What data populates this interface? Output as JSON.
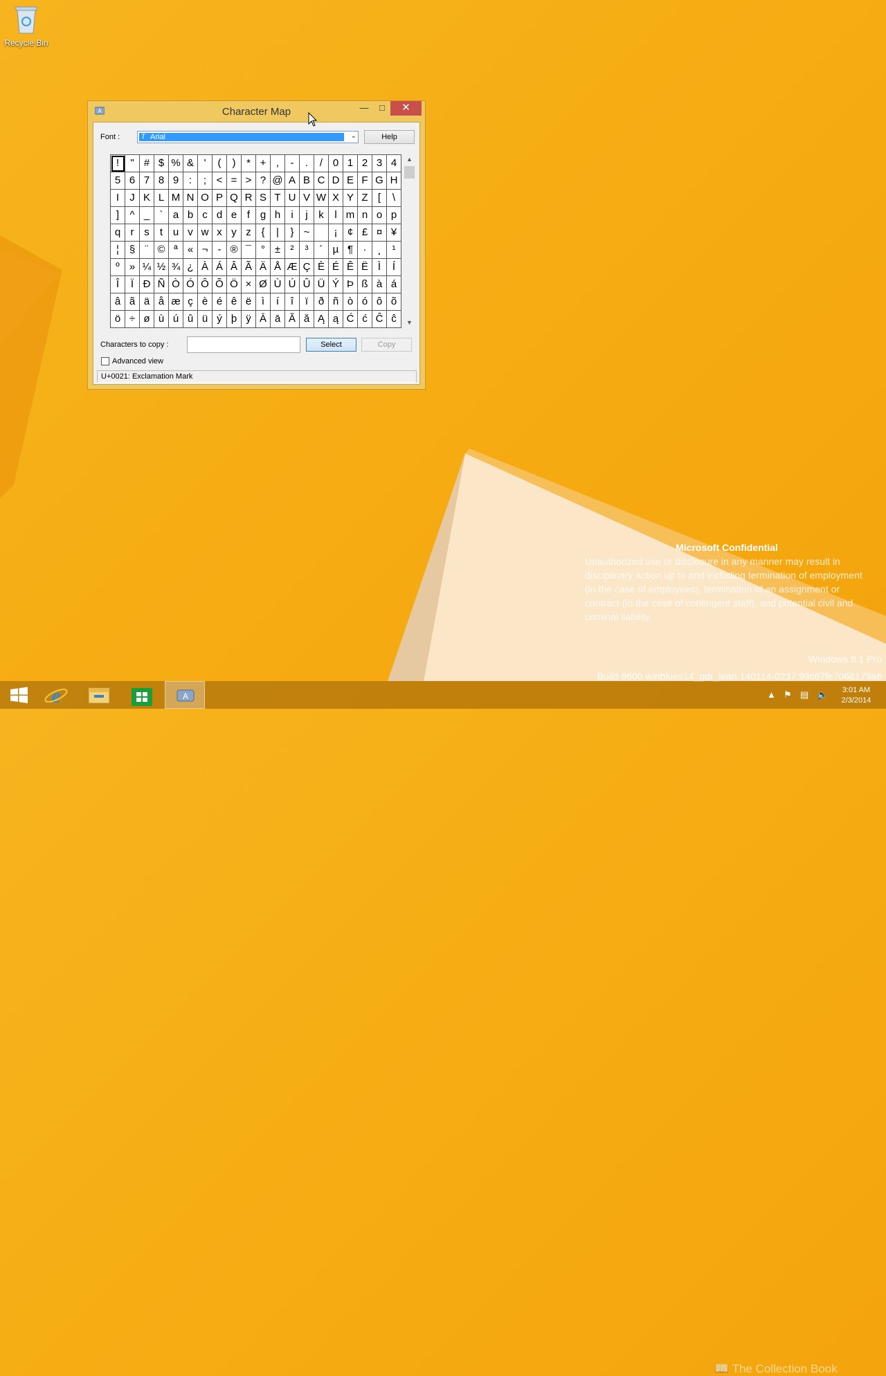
{
  "desktop": {
    "recycle_bin_label": "Recycle Bin"
  },
  "window": {
    "title": "Character Map",
    "font_label": "Font :",
    "font_value": "Arial",
    "help_label": "Help",
    "chars_to_copy_label": "Characters to copy :",
    "chars_to_copy_value": "",
    "select_label": "Select",
    "copy_label": "Copy",
    "advanced_label": "Advanced view",
    "advanced_checked": false,
    "status": "U+0021: Exclamation Mark",
    "selected_index": 0,
    "characters": [
      "!",
      "\"",
      "#",
      "$",
      "%",
      "&",
      "'",
      "(",
      ")",
      "*",
      "+",
      ",",
      "-",
      ".",
      "/",
      "0",
      "1",
      "2",
      "3",
      "4",
      "5",
      "6",
      "7",
      "8",
      "9",
      ":",
      ";",
      "<",
      "=",
      ">",
      "?",
      "@",
      "A",
      "B",
      "C",
      "D",
      "E",
      "F",
      "G",
      "H",
      "I",
      "J",
      "K",
      "L",
      "M",
      "N",
      "O",
      "P",
      "Q",
      "R",
      "S",
      "T",
      "U",
      "V",
      "W",
      "X",
      "Y",
      "Z",
      "[",
      "\\",
      "]",
      "^",
      "_",
      "`",
      "a",
      "b",
      "c",
      "d",
      "e",
      "f",
      "g",
      "h",
      "i",
      "j",
      "k",
      "l",
      "m",
      "n",
      "o",
      "p",
      "q",
      "r",
      "s",
      "t",
      "u",
      "v",
      "w",
      "x",
      "y",
      "z",
      "{",
      "|",
      "}",
      "~",
      " ",
      "¡",
      "¢",
      "£",
      "¤",
      "¥",
      "¦",
      "§",
      "¨",
      "©",
      "ª",
      "«",
      "¬",
      "-",
      "®",
      "¯",
      "°",
      "±",
      "²",
      "³",
      "´",
      "µ",
      "¶",
      "·",
      "¸",
      "¹",
      "º",
      "»",
      "¼",
      "½",
      "¾",
      "¿",
      "À",
      "Á",
      "Â",
      "Ã",
      "Ä",
      "Å",
      "Æ",
      "Ç",
      "È",
      "É",
      "Ê",
      "Ë",
      "Ì",
      "Í",
      "Î",
      "Ï",
      "Ð",
      "Ñ",
      "Ò",
      "Ó",
      "Ô",
      "Õ",
      "Ö",
      "×",
      "Ø",
      "Ù",
      "Ú",
      "Û",
      "Ü",
      "Ý",
      "Þ",
      "ß",
      "à",
      "á",
      "â",
      "ã",
      "ä",
      "å",
      "æ",
      "ç",
      "è",
      "é",
      "ê",
      "ë",
      "ì",
      "í",
      "î",
      "ï",
      "ð",
      "ñ",
      "ò",
      "ó",
      "ô",
      "õ",
      "ö",
      "÷",
      "ø",
      "ù",
      "ú",
      "û",
      "ü",
      "ý",
      "þ",
      "ÿ",
      "Ā",
      "ā",
      "Ă",
      "ă",
      "Ą",
      "ą",
      "Ć",
      "ć",
      "Ĉ",
      "ĉ"
    ]
  },
  "watermark": {
    "heading": "Microsoft Confidential",
    "body": "Unauthorized use or disclosure in any manner may result in disciplinary action up to and including termination of employment (in the case of employees), termination of an assignment or contract (in the case of contingent staff), and potential civil and criminal liability.",
    "edition": "Windows 8.1 Pro",
    "build": "Build 9600.winblues14_gdr_lean.140114-0237.93c67fe7066179a6"
  },
  "taskbar": {
    "time": "3:01 AM",
    "date": "2/3/2014",
    "overlay_text": "The Collection Book"
  }
}
